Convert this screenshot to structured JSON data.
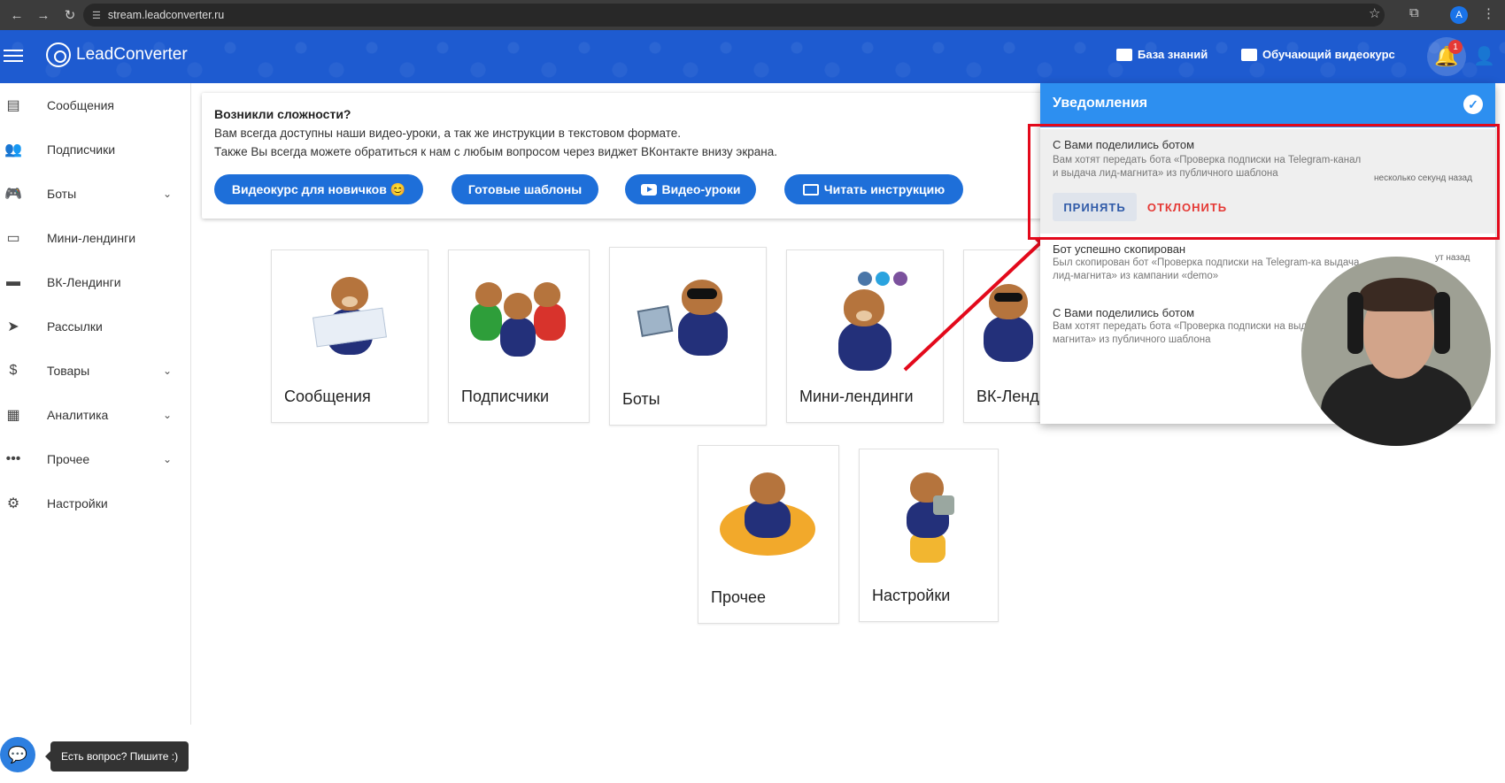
{
  "browser": {
    "url": "stream.leadconverter.ru",
    "profile_initial": "A"
  },
  "appbar": {
    "brand": "LeadConverter",
    "knowledge_base": "База знаний",
    "video_course": "Обучающий видеокурс",
    "notification_count": "1"
  },
  "sidebar": {
    "items": [
      {
        "label": "Сообщения",
        "icon": "message-icon"
      },
      {
        "label": "Подписчики",
        "icon": "people-icon"
      },
      {
        "label": "Боты",
        "icon": "gamepad-icon",
        "expandable": true
      },
      {
        "label": "Мини-лендинги",
        "icon": "window-icon"
      },
      {
        "label": "ВК-Лендинги",
        "icon": "card-icon"
      },
      {
        "label": "Рассылки",
        "icon": "send-icon"
      },
      {
        "label": "Товары",
        "icon": "dollar-icon",
        "expandable": true
      },
      {
        "label": "Аналитика",
        "icon": "chart-icon",
        "expandable": true
      },
      {
        "label": "Прочее",
        "icon": "more-icon",
        "expandable": true
      },
      {
        "label": "Настройки",
        "icon": "gear-icon"
      }
    ]
  },
  "help": {
    "title": "Возникли сложности?",
    "line1": "Вам всегда доступны наши видео-уроки, а так же инструкции в текстовом формате.",
    "line2": "Также Вы всегда можете обратиться к нам с любым вопросом через виджет ВКонтакте внизу экрана.",
    "btn_beginner": "Видеокурс для новичков 😊",
    "btn_templates": "Готовые шаблоны",
    "btn_video": "Видео-уроки",
    "btn_instructions": "Читать инструкцию"
  },
  "tiles": {
    "messages": "Сообщения",
    "subscribers": "Подписчики",
    "bots": "Боты",
    "mini_landings": "Мини-лендинги",
    "vk_landings": "ВК-Ленд",
    "other": "Прочее",
    "settings": "Настройки"
  },
  "notifications": {
    "title": "Уведомления",
    "items": [
      {
        "title": "С Вами поделились ботом",
        "body": "Вам хотят передать бота «Проверка подписки на Telegram-канал и выдача лид-магнита» из публичного шаблона",
        "time": "несколько секунд назад",
        "accept": "ПРИНЯТЬ",
        "decline": "ОТКЛОНИТЬ"
      },
      {
        "title": "Бот успешно скопирован",
        "body": "Был скопирован бот «Проверка подписки на Telegram-ка выдача лид-магнита» из кампании «demo»",
        "time": "ут назад"
      },
      {
        "title": "С Вами поделились ботом",
        "body": "Вам хотят передать бота «Проверка подписки на выдача лид-магнита» из публичного шаблона"
      }
    ]
  },
  "chat": {
    "tooltip": "Есть вопрос? Пишите :)"
  },
  "colors": {
    "appbar": "#1e5bd0",
    "primary_button": "#1e6fd9",
    "notif_header": "#2d8ff0",
    "highlight": "#e3091b"
  }
}
